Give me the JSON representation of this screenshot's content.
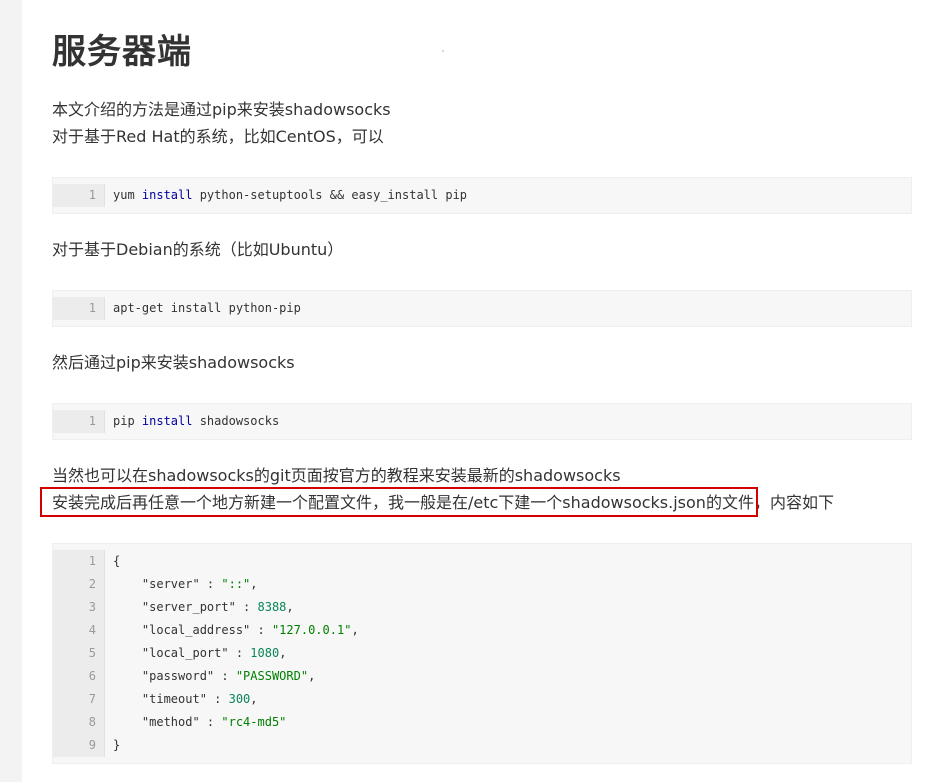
{
  "heading": "服务器端",
  "paragraphs": {
    "intro_line1": "本文介绍的方法是通过pip来安装shadowsocks",
    "intro_line2": "对于基于Red Hat的系统，比如CentOS，可以",
    "debian": "对于基于Debian的系统（比如Ubuntu）",
    "then": "然后通过pip来安装shadowsocks",
    "git_line": "当然也可以在shadowsocks的git页面按官方的教程来安装最新的shadowsocks",
    "config_highlighted": "安装完成后再任意一个地方新建一个配置文件，我一般是在/etc下建一个shadowsocks.json的文件，",
    "config_rest": "内容如下"
  },
  "code_blocks": {
    "yum": {
      "line_numbers": [
        "1"
      ],
      "lines": [
        [
          {
            "t": "yum "
          },
          {
            "t": "install",
            "c": "kw"
          },
          {
            "t": " python-setuptools && easy_install pip"
          }
        ]
      ]
    },
    "apt": {
      "line_numbers": [
        "1"
      ],
      "lines": [
        [
          {
            "t": "apt-get install python-pip"
          }
        ]
      ]
    },
    "pip": {
      "line_numbers": [
        "1"
      ],
      "lines": [
        [
          {
            "t": "pip "
          },
          {
            "t": "install",
            "c": "kw"
          },
          {
            "t": " shadowsocks"
          }
        ]
      ]
    },
    "json": {
      "line_numbers": [
        "1",
        "2",
        "3",
        "4",
        "5",
        "6",
        "7",
        "8",
        "9"
      ],
      "lines": [
        [
          {
            "t": "{"
          }
        ],
        [
          {
            "t": "    \"server\" : "
          },
          {
            "t": "\"::\"",
            "c": "str"
          },
          {
            "t": ","
          }
        ],
        [
          {
            "t": "    \"server_port\" : "
          },
          {
            "t": "8388",
            "c": "num"
          },
          {
            "t": ","
          }
        ],
        [
          {
            "t": "    \"local_address\" : "
          },
          {
            "t": "\"127.0.0.1\"",
            "c": "str"
          },
          {
            "t": ","
          }
        ],
        [
          {
            "t": "    \"local_port\" : "
          },
          {
            "t": "1080",
            "c": "num"
          },
          {
            "t": ","
          }
        ],
        [
          {
            "t": "    \"password\" : "
          },
          {
            "t": "\"PASSWORD\"",
            "c": "str"
          },
          {
            "t": ","
          }
        ],
        [
          {
            "t": "    \"timeout\" : "
          },
          {
            "t": "300",
            "c": "num"
          },
          {
            "t": ","
          }
        ],
        [
          {
            "t": "    \"method\" : "
          },
          {
            "t": "\"rc4-md5\"",
            "c": "str"
          }
        ],
        [
          {
            "t": "}"
          }
        ]
      ]
    }
  },
  "colors": {
    "highlight_border": "#d40000",
    "keyword": "#0000a0",
    "string": "#008000",
    "number": "#098658"
  }
}
